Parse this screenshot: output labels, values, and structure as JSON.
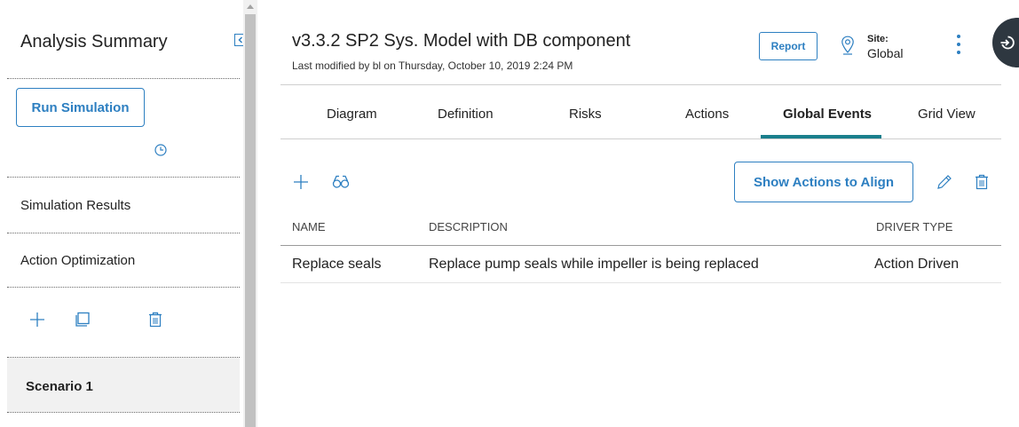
{
  "sidebar": {
    "title": "Analysis Summary",
    "run_button": "Run Simulation",
    "items": [
      {
        "label": "Simulation Results"
      },
      {
        "label": "Action Optimization"
      }
    ],
    "scenario": {
      "label": "Scenario 1"
    }
  },
  "header": {
    "title": "v3.3.2 SP2 Sys. Model with DB component",
    "subtitle": "Last modified by bl on Thursday, October 10, 2019 2:24 PM",
    "report_button": "Report",
    "site_label": "Site:",
    "site_value": "Global"
  },
  "tabs": [
    {
      "label": "Diagram",
      "active": false
    },
    {
      "label": "Definition",
      "active": false
    },
    {
      "label": "Risks",
      "active": false
    },
    {
      "label": "Actions",
      "active": false
    },
    {
      "label": "Global Events",
      "active": true
    },
    {
      "label": "Grid View",
      "active": false
    }
  ],
  "toolbar": {
    "align_button": "Show Actions to Align"
  },
  "table": {
    "columns": [
      "NAME",
      "DESCRIPTION",
      "DRIVER TYPE"
    ],
    "rows": [
      [
        "Replace seals",
        "Replace pump seals while impeller is being replaced",
        "Action Driven"
      ]
    ]
  },
  "colors": {
    "accent": "#2d7fc1",
    "tab_indicator": "#1a7f8c",
    "fab": "#2e3740"
  },
  "icons": [
    "collapse-left-icon",
    "clock-icon",
    "plus-icon",
    "copy-icon",
    "trash-icon",
    "location-pin-icon",
    "kebab-menu-icon",
    "exit-icon",
    "binoculars-icon",
    "pencil-icon"
  ]
}
